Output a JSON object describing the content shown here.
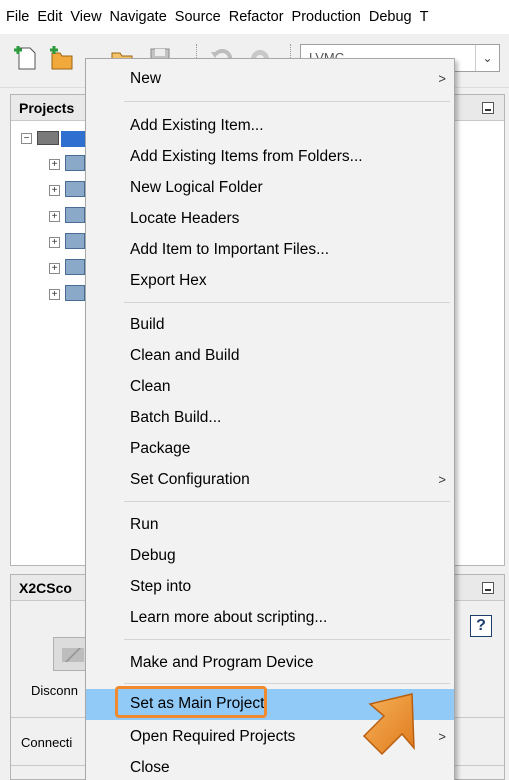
{
  "menubar": {
    "items": [
      "File",
      "Edit",
      "View",
      "Navigate",
      "Source",
      "Refactor",
      "Production",
      "Debug",
      "T"
    ]
  },
  "toolbar": {
    "config_value": "LVMC",
    "icons": [
      "new-file-icon",
      "new-project-icon",
      "open-project-icon",
      "save-icon",
      "undo-icon",
      "redo-icon"
    ]
  },
  "projects_panel": {
    "title": "Projects"
  },
  "scope_panel": {
    "title": "X2CSco",
    "status": "Disconn",
    "tab": "Connecti",
    "help": "?"
  },
  "context_menu": {
    "groups": [
      [
        {
          "label": "New",
          "submenu": true
        }
      ],
      [
        {
          "label": "Add Existing Item..."
        },
        {
          "label": "Add Existing Items from Folders..."
        },
        {
          "label": "New Logical Folder"
        },
        {
          "label": "Locate Headers"
        },
        {
          "label": "Add Item to Important Files..."
        },
        {
          "label": "Export Hex"
        }
      ],
      [
        {
          "label": "Build"
        },
        {
          "label": "Clean and Build"
        },
        {
          "label": "Clean"
        },
        {
          "label": "Batch Build..."
        },
        {
          "label": "Package"
        },
        {
          "label": "Set Configuration",
          "submenu": true
        }
      ],
      [
        {
          "label": "Run"
        },
        {
          "label": "Debug"
        },
        {
          "label": "Step into"
        },
        {
          "label": "Learn more about scripting..."
        }
      ],
      [
        {
          "label": "Make and Program Device"
        }
      ],
      [
        {
          "label": "Set as Main Project",
          "highlighted": true
        },
        {
          "label": "Open Required Projects",
          "submenu": true
        },
        {
          "label": "Close"
        }
      ]
    ],
    "submenu_glyph": ">"
  },
  "colors": {
    "highlight": "#91c9f7",
    "annotation": "#ef8a2e"
  }
}
